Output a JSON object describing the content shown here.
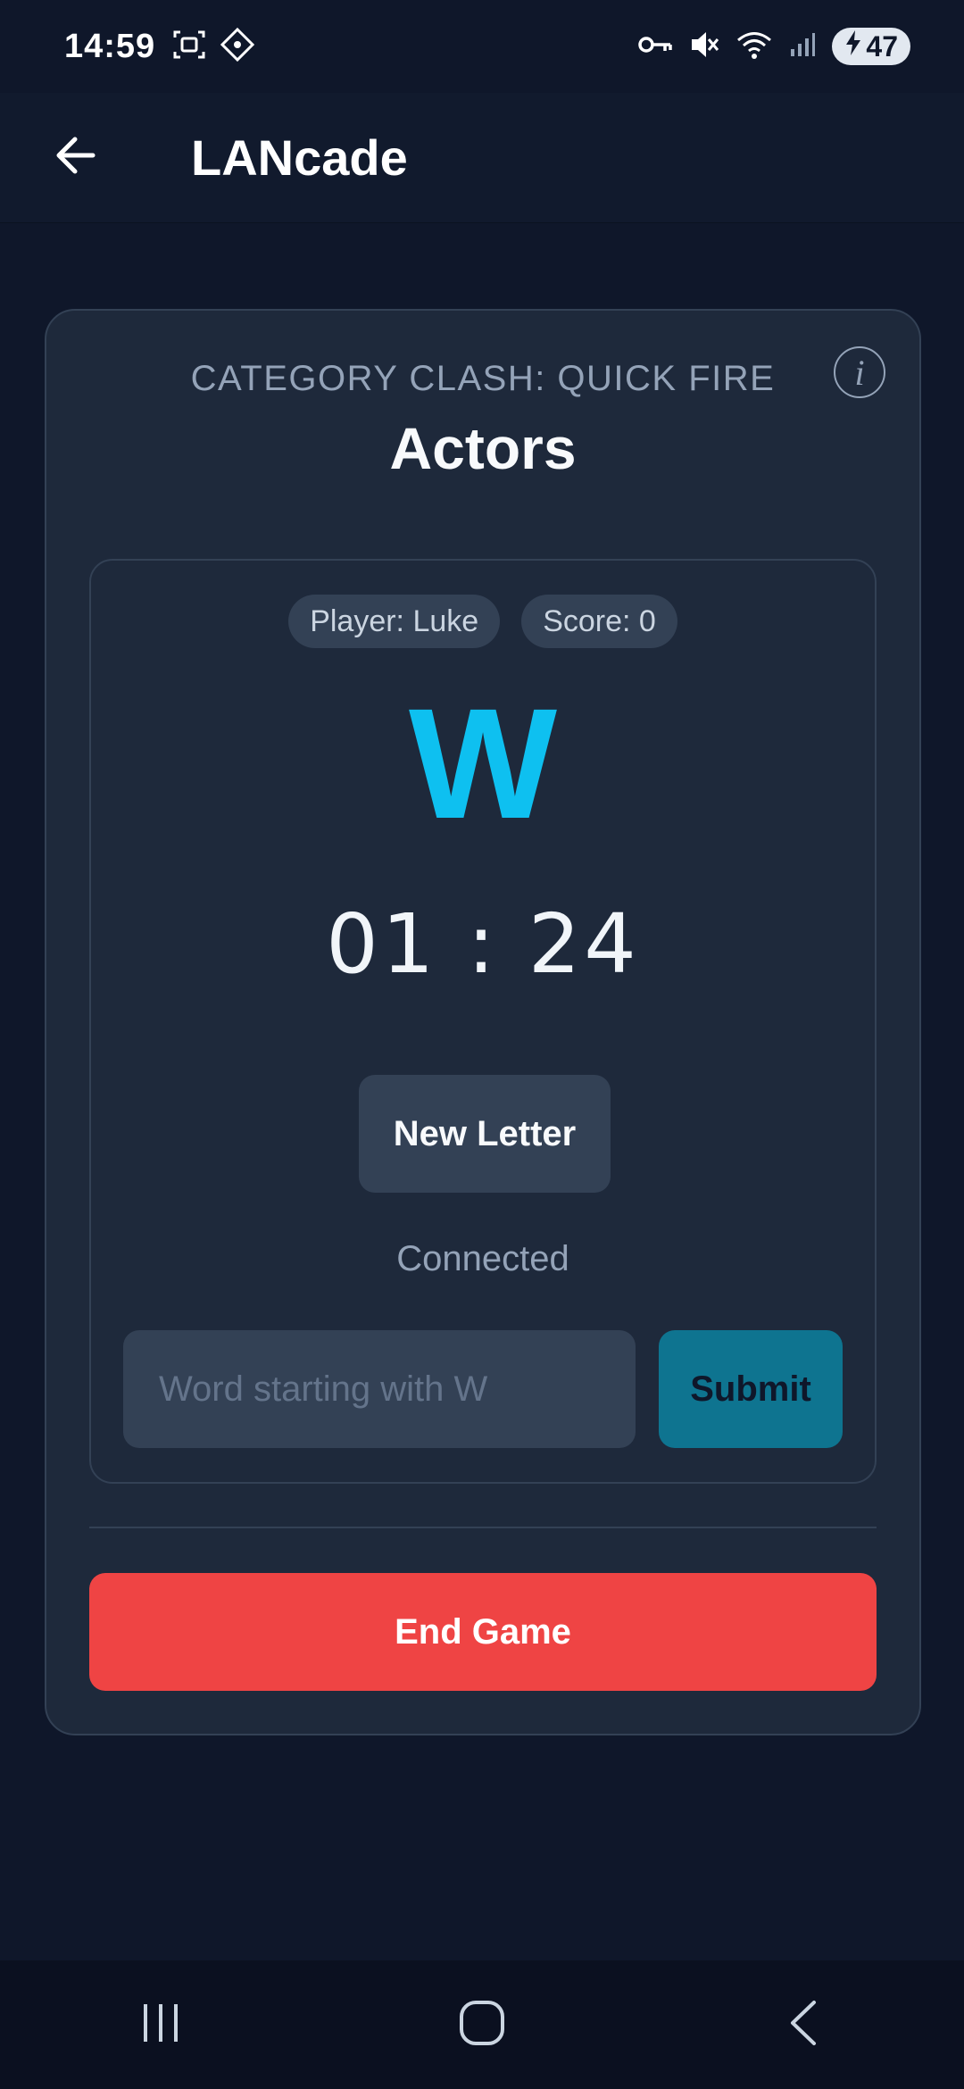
{
  "status_bar": {
    "time": "14:59",
    "battery_level": "47",
    "icons": [
      "screenshot-icon",
      "diamond-icon",
      "vpn-key-icon",
      "mute-icon",
      "wifi-icon",
      "signal-icon",
      "battery-charging-icon"
    ]
  },
  "app_bar": {
    "title": "LANcade",
    "back_icon": "arrow-left-icon"
  },
  "card": {
    "subtitle": "CATEGORY CLASH: QUICK FIRE",
    "category": "Actors",
    "info_icon": "info-icon",
    "info_glyph": "i"
  },
  "game": {
    "player_label": "Player: Luke",
    "score_label": "Score: 0",
    "letter": "W",
    "timer": "01 : 24",
    "new_letter_label": "New Letter",
    "connection_status": "Connected",
    "word_input": {
      "value": "",
      "placeholder": "Word starting with W"
    },
    "submit_label": "Submit",
    "end_game_label": "End Game"
  },
  "nav_bar": {
    "icons": [
      "recent-apps-icon",
      "home-icon",
      "back-nav-icon"
    ]
  },
  "colors": {
    "background": "#0f172a",
    "card": "#1e293b",
    "accent_letter": "#0ec0f0",
    "submit": "#0e7490",
    "danger": "#ef4444"
  }
}
